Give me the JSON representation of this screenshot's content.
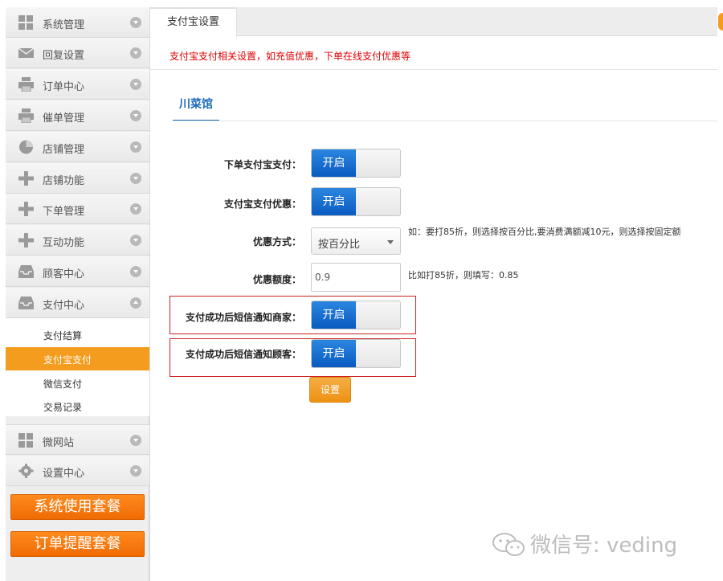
{
  "sidebar": {
    "items": [
      {
        "label": "系统管理",
        "icon": "grid-icon"
      },
      {
        "label": "回复设置",
        "icon": "mail-icon"
      },
      {
        "label": "订单中心",
        "icon": "printer-icon"
      },
      {
        "label": "催单管理",
        "icon": "printer-icon"
      },
      {
        "label": "店铺管理",
        "icon": "pie-icon"
      },
      {
        "label": "店铺功能",
        "icon": "plus-icon"
      },
      {
        "label": "下单管理",
        "icon": "plus-icon"
      },
      {
        "label": "互动功能",
        "icon": "plus-icon"
      },
      {
        "label": "顾客中心",
        "icon": "inbox-icon"
      },
      {
        "label": "支付中心",
        "icon": "inbox-icon"
      }
    ],
    "sub_items": [
      "支付结算",
      "支付宝支付",
      "微信支付",
      "交易记录"
    ],
    "active_sub": "支付宝支付",
    "more_items": [
      {
        "label": "微网站",
        "icon": "grid-icon"
      },
      {
        "label": "设置中心",
        "icon": "gear-icon"
      }
    ],
    "buttons": [
      "系统使用套餐",
      "订单提醒套餐"
    ]
  },
  "main": {
    "tab_label": "支付宝设置",
    "notice": "支付宝支付相关设置，如充值优惠，下单在线支付优惠等",
    "shop_tab": "川菜馆",
    "form": {
      "alipay_order": {
        "label": "下单支付宝支付：",
        "state": "开启"
      },
      "alipay_discount": {
        "label": "支付宝支付优惠：",
        "state": "开启"
      },
      "discount_method": {
        "label": "优惠方式：",
        "value": "按百分比",
        "hint": "如：要打85折，则选择按百分比,要消费满额减10元，则选择按固定额"
      },
      "discount_amount": {
        "label": "优惠额度：",
        "value": "0.9",
        "hint": "比如打85折，则填写：0.85"
      },
      "notify_merchant": {
        "label": "支付成功后短信通知商家：",
        "state": "开启"
      },
      "notify_customer": {
        "label": "支付成功后短信通知顾客：",
        "state": "开启"
      }
    },
    "submit_label": "设置"
  },
  "watermark": "微信号: veding",
  "colors": {
    "accent": "#f39c1e",
    "toggle_on": "#0a5bc0",
    "notice": "#dd0000",
    "link": "#1e6bb8"
  }
}
